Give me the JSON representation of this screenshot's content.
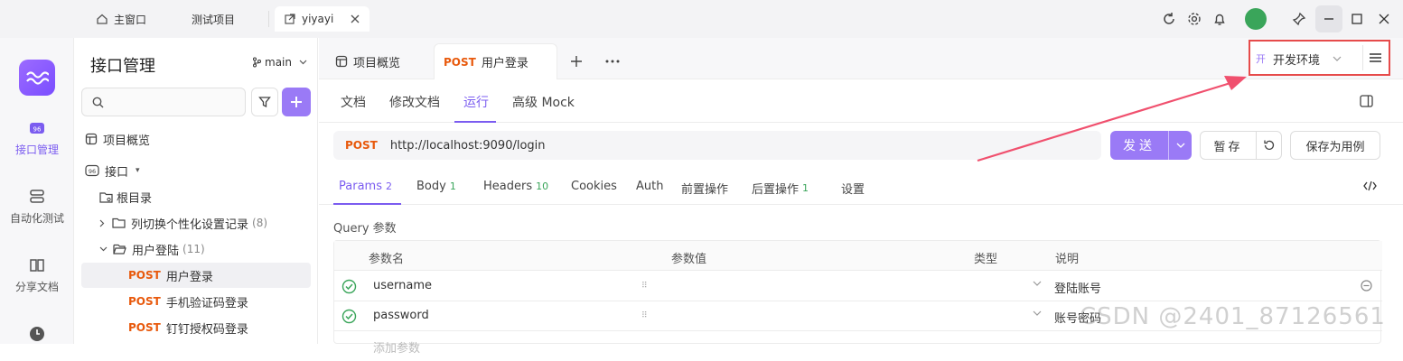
{
  "titlebar": {
    "home_label": "主窗口",
    "project_label": "测试项目",
    "active_tab_label": "yiyayi"
  },
  "rail": {
    "items": [
      {
        "label": "接口管理",
        "icon": "api-icon"
      },
      {
        "label": "自动化测试",
        "icon": "automation-icon"
      },
      {
        "label": "分享文档",
        "icon": "book-icon"
      },
      {
        "label": "",
        "icon": "clock-icon"
      }
    ]
  },
  "tree": {
    "title": "接口管理",
    "branch": "main",
    "rows": [
      {
        "label": "项目概览"
      },
      {
        "label": "接口"
      },
      {
        "label": "根目录"
      },
      {
        "label": "列切换个性化设置记录",
        "count": "(8)"
      },
      {
        "label": "用户登陆",
        "count": "(11)"
      },
      {
        "method": "POST",
        "label": "用户登录"
      },
      {
        "method": "POST",
        "label": "手机验证码登录"
      },
      {
        "method": "POST",
        "label": "钉钉授权码登录"
      }
    ]
  },
  "tabs": {
    "overview": "项目概览",
    "active_method": "POST",
    "active_label": "用户登录"
  },
  "env": {
    "badge": "开",
    "label": "开发环境"
  },
  "subtabs": [
    "文档",
    "修改文档",
    "运行",
    "高级 Mock"
  ],
  "request": {
    "method": "POST",
    "url": "http://localhost:9090/login",
    "send": "发送",
    "save_temp": "暂存",
    "save_case": "保存为用例"
  },
  "reqtabs": [
    {
      "label": "Params",
      "count": "2"
    },
    {
      "label": "Body",
      "count": "1"
    },
    {
      "label": "Headers",
      "count": "10"
    },
    {
      "label": "Cookies",
      "count": ""
    },
    {
      "label": "Auth",
      "count": ""
    },
    {
      "label": "前置操作",
      "count": ""
    },
    {
      "label": "后置操作",
      "count": "1"
    },
    {
      "label": "设置",
      "count": ""
    }
  ],
  "params": {
    "section": "Query 参数",
    "headers": [
      "参数名",
      "参数值",
      "类型",
      "说明"
    ],
    "rows": [
      {
        "name": "username",
        "desc": "登陆账号"
      },
      {
        "name": "password",
        "desc": "账号密码"
      }
    ],
    "add_placeholder": "添加参数"
  },
  "watermark": "CSDN @2401_87126561",
  "colors": {
    "accent": "#7b5cf0",
    "method_post": "#e8590c",
    "highlight": "#e64b4b"
  }
}
